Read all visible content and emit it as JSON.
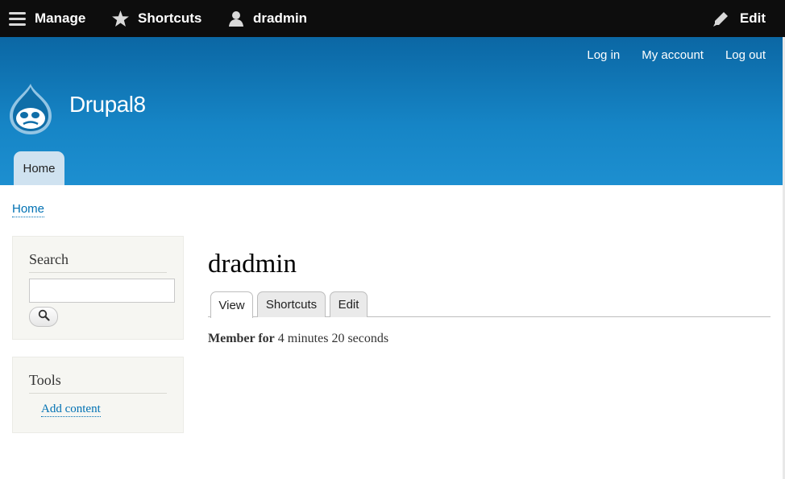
{
  "toolbar": {
    "manage_label": "Manage",
    "shortcuts_label": "Shortcuts",
    "user_label": "dradmin",
    "edit_label": "Edit"
  },
  "header": {
    "secondary_nav": [
      "Log in",
      "My account",
      "Log out"
    ],
    "site_name": "Drupal8",
    "main_tab": "Home",
    "gradient_top": "#0b67a4",
    "gradient_bottom": "#1d8fd0"
  },
  "breadcrumb": "Home",
  "sidebar": {
    "search": {
      "title": "Search",
      "value": "",
      "button_icon": "search-icon"
    },
    "tools": {
      "title": "Tools",
      "link": "Add content"
    }
  },
  "main": {
    "title": "dradmin",
    "tabs": [
      "View",
      "Shortcuts",
      "Edit"
    ],
    "member_label": "Member for",
    "member_value": "4 minutes 20 seconds"
  },
  "colors": {
    "link": "#0071b3",
    "toolbar_bg": "#0d0d0d"
  }
}
